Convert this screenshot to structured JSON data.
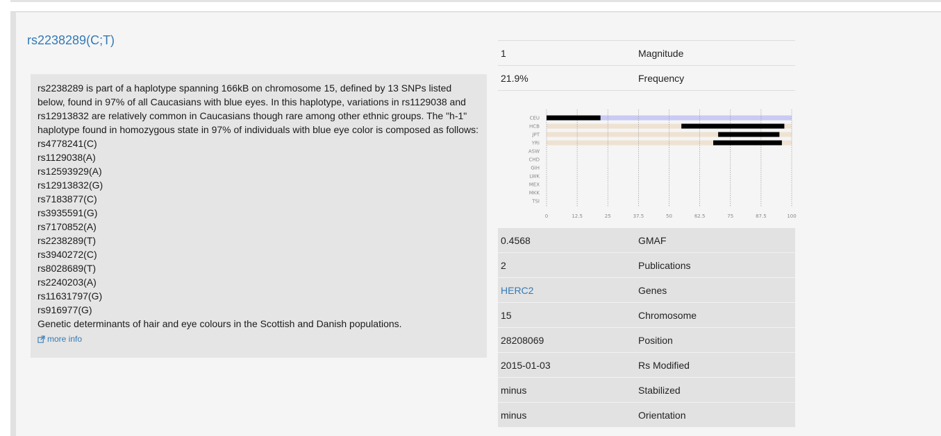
{
  "snp": {
    "title": "rs2238289(C;T)",
    "description": "rs2238289 is part of a haplotype spanning 166kB on chromosome 15, defined by 13 SNPs listed below, found in 97% of all Caucasians with blue eyes. In this haplotype, variations in rs1129038 and rs12913832 are relatively common in Caucasians though rare among other ethnic groups. The \"h-1\" haplotype found in homozygous state in 97% of individuals with blue eye color is composed as follows:",
    "haplotype": [
      "rs4778241(C)",
      "rs1129038(A)",
      "rs12593929(A)",
      "rs12913832(G)",
      "rs7183877(C)",
      "rs3935591(G)",
      "rs7170852(A)",
      "rs2238289(T)",
      "rs3940272(C)",
      "rs8028689(T)",
      "rs2240203(A)",
      "rs11631797(G)",
      "rs916977(G)"
    ],
    "footnote": "Genetic determinants of hair and eye colours in the Scottish and Danish populations.",
    "more_info": "more info",
    "more_info_icon": "external-link-icon"
  },
  "top_table": [
    {
      "value": "1",
      "label": "Magnitude"
    },
    {
      "value": "21.9%",
      "label": "Frequency"
    }
  ],
  "bottom_table": [
    {
      "value": "0.4568",
      "label": "GMAF"
    },
    {
      "value": "2",
      "label": "Publications"
    },
    {
      "value": "HERC2",
      "label": "Genes",
      "link": true
    },
    {
      "value": "15",
      "label": "Chromosome"
    },
    {
      "value": "28208069",
      "label": "Position"
    },
    {
      "value": "2015-01-03",
      "label": "Rs Modified"
    },
    {
      "value": "minus",
      "label": "Stabilized"
    },
    {
      "value": "minus",
      "label": "Orientation"
    }
  ],
  "chart_data": {
    "type": "bar",
    "categories": [
      "CEU",
      "HCB",
      "JPT",
      "YRI",
      "ASW",
      "CHD",
      "GIH",
      "LWK",
      "MEX",
      "MKK",
      "TSI"
    ],
    "x_ticks": [
      "0",
      "12.5",
      "25",
      "37.5",
      "50",
      "62.5",
      "75",
      "87.5",
      "100"
    ],
    "xlim": [
      0,
      100
    ],
    "bars": [
      {
        "pop": "CEU",
        "start": 0,
        "end": 22,
        "bg": "lavender"
      },
      {
        "pop": "HCB",
        "start": 55,
        "end": 97,
        "bg": "beige"
      },
      {
        "pop": "JPT",
        "start": 70,
        "end": 95,
        "bg": "beige"
      },
      {
        "pop": "YRI",
        "start": 68,
        "end": 96,
        "bg": "beige"
      }
    ],
    "colors": {
      "lavender": "#c9caf5",
      "beige": "#efe2d2",
      "bar": "#000000",
      "grid": "#999999"
    }
  }
}
